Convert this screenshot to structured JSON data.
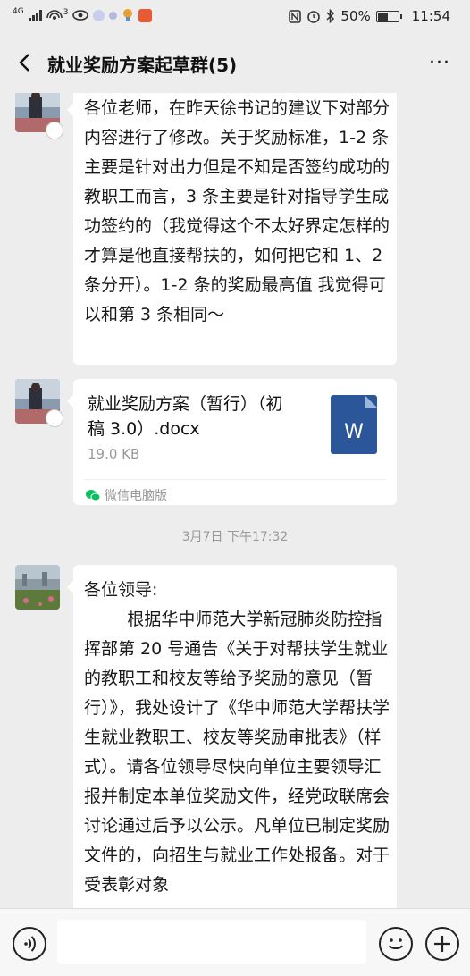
{
  "status_bar": {
    "network": "4G",
    "wifi_badge": "3",
    "battery": "50%",
    "battery_level": 0.5,
    "time": "11:54"
  },
  "header": {
    "title": "就业奖励方案起草群(5)",
    "back_icon": "chevron-left-icon",
    "more_icon": "more-dots-icon",
    "more_label": "···"
  },
  "messages": [
    {
      "type": "text",
      "text": "各位老师，在昨天徐书记的建议下对部分内容进行了修改。关于奖励标准，1-2 条主要是针对出力但是不知是否签约成功的教职工而言，3 条主要是针对指导学生成功签约的（我觉得这个不太好界定怎样的才算是他直接帮扶的，如何把它和 1、2 条分开）。1-2 条的奖励最高值 我觉得可以和第 3 条相同～"
    },
    {
      "type": "file",
      "file_name": "就业奖励方案（暂行）（初稿 3.0）.docx",
      "file_size": "19.0 KB",
      "file_icon_letter": "W",
      "source": "微信电脑版"
    },
    {
      "type": "timestamp",
      "text": "3月7日 下午17:32"
    },
    {
      "type": "text",
      "text": "各位领导:\n        根据华中师范大学新冠肺炎防控指挥部第 20 号通告《关于对帮扶学生就业的教职工和校友等给予奖励的意见（暂行）》，我处设计了《华中师范大学帮扶学生就业教职工、校友等奖励审批表》（样式）。请各位领导尽快向单位主要领导汇报并制定本单位奖励文件，经党政联席会讨论通过后予以公示。凡单位已制定奖励文件的，向招生与就业工作处报备。对于受表彰对象"
    }
  ],
  "input_bar": {
    "voice_icon": "voice-icon",
    "emoji_icon": "emoji-icon",
    "plus_icon": "plus-icon",
    "input_value": ""
  },
  "colors": {
    "background": "#ededed",
    "bubble": "#ffffff",
    "word_blue": "#2b579a",
    "wechat_green": "#07c160"
  }
}
